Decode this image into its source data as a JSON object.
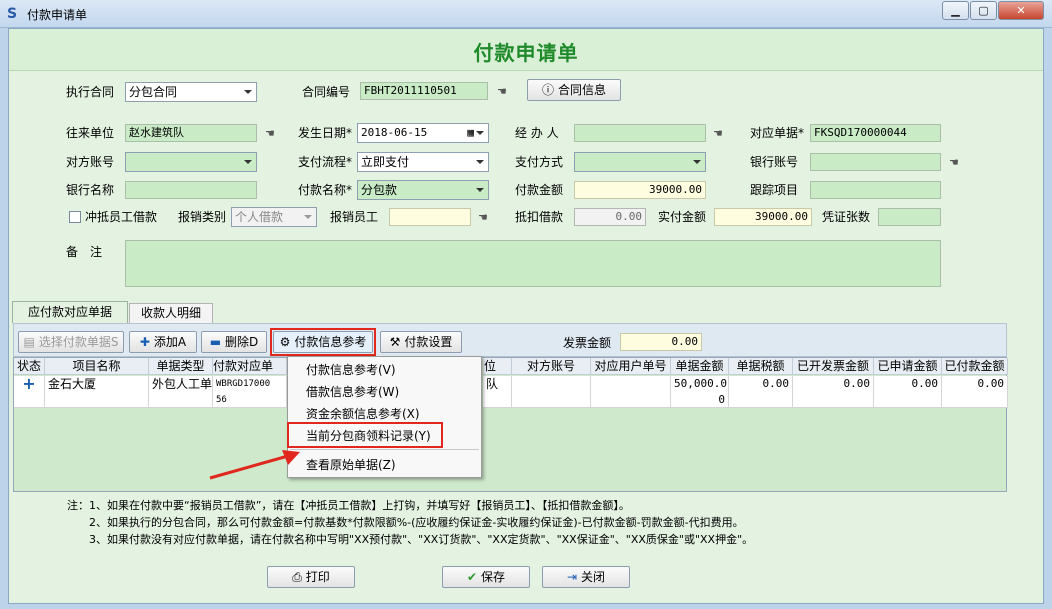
{
  "window": {
    "title": "付款申请单",
    "minimize": "0",
    "maximize": "1",
    "close": "r"
  },
  "form": {
    "title": "付款申请单"
  },
  "contract": {
    "exec_label": "执行合同",
    "exec_value": "分包合同",
    "no_label": "合同编号",
    "no_value": "FBHT2011110501",
    "info_button": "合同信息"
  },
  "fields": {
    "wanglai_label": "往来单位",
    "wanglai_value": "赵水建筑队",
    "date_label": "发生日期*",
    "date_value": "2018-06-15",
    "handler_label": "经 办 人",
    "handler_value": "",
    "doc_label": "对应单据*",
    "doc_value": "FKSQD170000044",
    "account_label": "对方账号",
    "account_value": "",
    "flow_label": "支付流程*",
    "flow_value": "立即支付",
    "paymethod_label": "支付方式",
    "paymethod_value": "",
    "bankacct_label": "银行账号",
    "bankacct_value": "",
    "bankname_label": "银行名称",
    "bankname_value": "",
    "payname_label": "付款名称*",
    "payname_value": "分包款",
    "amount_label": "付款金额",
    "amount_value": "39000.00",
    "track_label": "跟踪项目",
    "track_value": "",
    "offset_label": "冲抵员工借款",
    "reimb_type_label": "报销类别",
    "reimb_type_value": "个人借款",
    "reimb_emp_label": "报销员工",
    "reimb_emp_value": "",
    "deduct_label": "抵扣借款",
    "deduct_value": "0.00",
    "actual_label": "实付金额",
    "actual_value": "39000.00",
    "voucher_label": "凭证张数",
    "voucher_value": "",
    "remark_label": "备　注",
    "remark_value": ""
  },
  "tabs": [
    {
      "label": "应付款对应单据"
    },
    {
      "label": "收款人明细"
    }
  ],
  "toolbar": {
    "select_btn": "选择付款单据S",
    "add_btn": "添加A",
    "delete_btn": "删除D",
    "ref_btn": "付款信息参考",
    "settings_btn": "付款设置",
    "invoice_label": "发票金额",
    "invoice_value": "0.00"
  },
  "grid": {
    "headers": [
      "状态",
      "项目名称",
      "单据类型",
      "付款对应单",
      "位",
      "对方账号",
      "对应用户单号",
      "单据金额",
      "单据税额",
      "已开发票金额",
      "已申请金额",
      "已付款金额"
    ],
    "row": {
      "status": "+",
      "project": "金石大厦",
      "doctype": "外包人工单",
      "docno": "WBRGD17000",
      "docno2": "56",
      "unit": "队",
      "account": "",
      "userno": "",
      "amount": "50,000.0",
      "amount2": "0",
      "tax": "0.00",
      "invoiced": "0.00",
      "applied": "0.00",
      "paid": "0.00"
    }
  },
  "menu": {
    "items": [
      "付款信息参考(V)",
      "借款信息参考(W)",
      "资金余额信息参考(X)",
      "当前分包商领料记录(Y)",
      "查看原始单据(Z)"
    ]
  },
  "notes": [
    "注：1、如果在付款中要“报销员工借款”，请在【冲抵员工借款】上打钩，并填写好【报销员工】、【抵扣借款金额】。",
    "　　2、如果执行的分包合同，那么可付款金额=付款基数*付款限额%-(应收履约保证金-实收履约保证金)-已付款金额-罚款金额-代扣费用。",
    "　　3、如果付款没有对应付款单据，请在付款名称中写明\"XX预付款\"、\"XX订货款\"、\"XX定货款\"、\"XX保证金\"、\"XX质保金\"或\"XX押金\"。"
  ],
  "buttons": {
    "print": "打印",
    "save": "保存",
    "close": "关闭"
  },
  "colors": {
    "title_green": "#1f8a2a",
    "field_green": "#c9ecc7",
    "highlight_red": "#e0281e"
  }
}
